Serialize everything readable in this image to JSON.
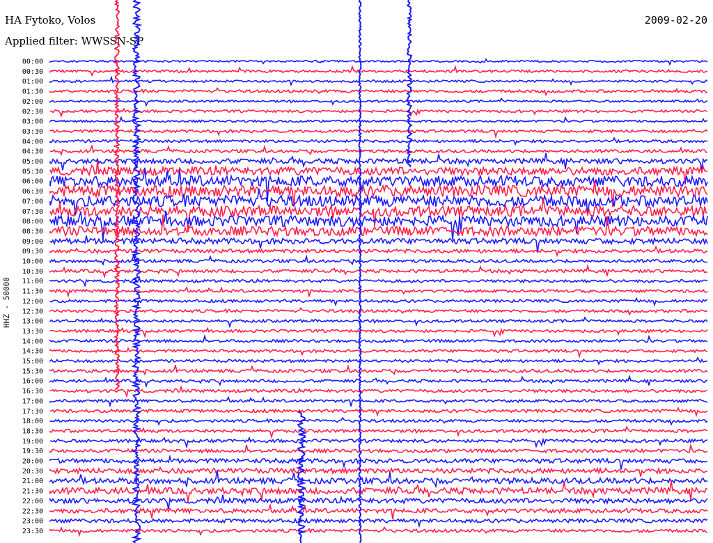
{
  "header": {
    "station": "HA Fytoko, Volos",
    "filter": "Applied filter: WWSSN-SP",
    "date": "2009-02-20"
  },
  "channel_label": "HHZ - 50000",
  "chart_data": {
    "type": "line",
    "title": "HA Fytoko, Volos",
    "subtitle": "Applied filter: WWSSN-SP",
    "ylabel": "HHZ - 50000",
    "xlabel": "",
    "grid": false,
    "row_interval_minutes": 30,
    "colors": [
      "#1a1aff",
      "#ff1f4a"
    ],
    "row_labels": [
      "00:00",
      "00:30",
      "01:00",
      "01:30",
      "02:00",
      "02:30",
      "03:00",
      "03:30",
      "04:00",
      "04:30",
      "05:00",
      "05:30",
      "06:00",
      "06:30",
      "07:00",
      "07:30",
      "08:00",
      "08:30",
      "09:00",
      "09:30",
      "10:00",
      "10:30",
      "11:00",
      "11:30",
      "12:00",
      "12:30",
      "13:00",
      "13:30",
      "14:00",
      "14:30",
      "15:00",
      "15:30",
      "16:00",
      "16:30",
      "17:00",
      "17:30",
      "18:00",
      "18:30",
      "19:00",
      "19:30",
      "20:00",
      "20:30",
      "21:00",
      "21:30",
      "22:00",
      "22:30",
      "23:00",
      "23:30"
    ],
    "noise_level": [
      0.6,
      0.8,
      0.7,
      0.9,
      0.7,
      0.8,
      0.7,
      0.9,
      0.9,
      1.0,
      1.6,
      2.6,
      3.4,
      3.6,
      3.6,
      3.4,
      3.4,
      3.0,
      1.8,
      1.2,
      1.0,
      1.0,
      0.9,
      0.9,
      0.9,
      0.9,
      0.9,
      0.9,
      0.9,
      0.9,
      0.9,
      1.0,
      0.9,
      1.0,
      0.9,
      1.0,
      0.9,
      1.0,
      1.0,
      1.1,
      1.4,
      1.6,
      1.8,
      2.0,
      1.6,
      1.4,
      1.2,
      1.0
    ]
  }
}
